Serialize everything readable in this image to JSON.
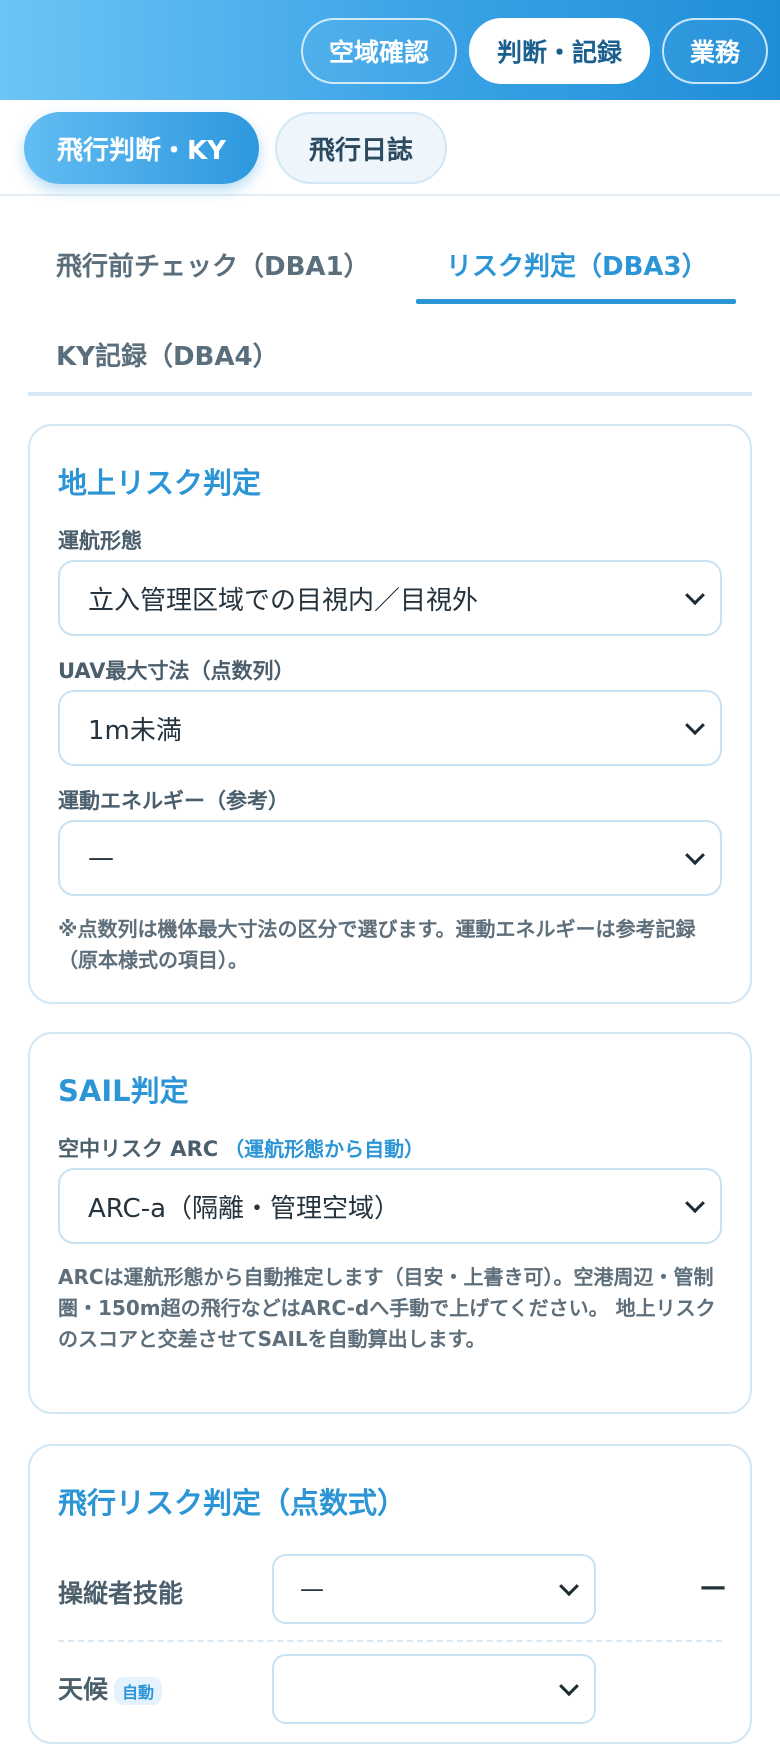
{
  "top_nav": {
    "items": [
      "空域確認",
      "判断・記録",
      "業務"
    ],
    "active_index": 1
  },
  "sub_tabs": {
    "active": "飛行判断・KY",
    "inactive": "飛行日誌"
  },
  "section_tabs": {
    "tab1": "飛行前チェック（DBA1）",
    "tab2": "リスク判定（DBA3）",
    "tab3": "KY記録（DBA4）",
    "active": "リスク判定（DBA3）"
  },
  "ground_risk": {
    "title": "地上リスク判定",
    "operation_label": "運航形態",
    "operation_value": "立入管理区域での目視内／目視外",
    "uav_size_label": "UAV最大寸法（点数列）",
    "uav_size_value": "1m未満",
    "kinetic_label": "運動エネルギー（参考）",
    "kinetic_value": "—",
    "note": "※点数列は機体最大寸法の区分で選びます。運動エネルギーは参考記録（原本様式の項目）。"
  },
  "sail": {
    "title": "SAIL判定",
    "arc_label": "空中リスク ARC",
    "arc_auto": "（運航形態から自動）",
    "arc_value": "ARC-a（隔離・管理空域）",
    "note": "ARCは運航形態から自動推定します（目安・上書き可）。空港周辺・管制圏・150m超の飛行などはARC-dへ手動で上げてください。 地上リスクのスコアと交差させてSAILを自動算出します。"
  },
  "flight_risk": {
    "title": "飛行リスク判定（点数式）",
    "rows": [
      {
        "label": "操縦者技能",
        "badge": "",
        "value": "—",
        "score": "—"
      },
      {
        "label": "天候",
        "badge": "自動",
        "value": "",
        "score": ""
      }
    ]
  },
  "colors": {
    "accent": "#2b95d6",
    "header_gradient_start": "#6cc4f5",
    "header_gradient_end": "#1f8ed8"
  }
}
